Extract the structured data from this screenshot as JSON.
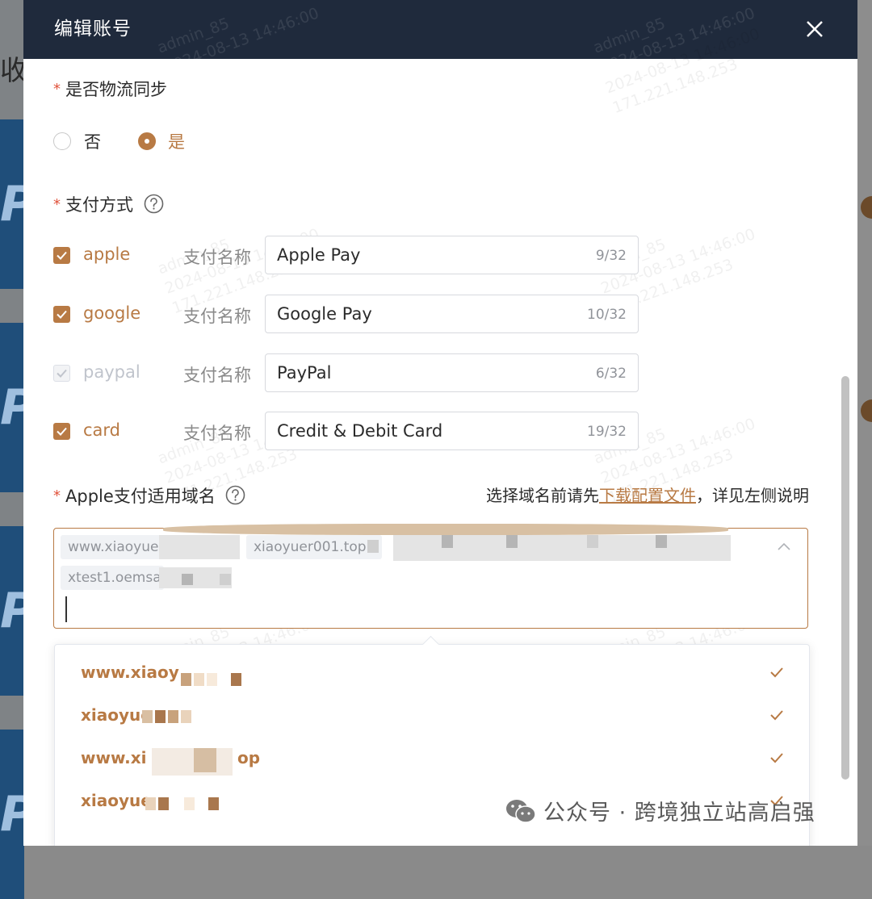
{
  "background": {
    "title_fragment": "收"
  },
  "modal": {
    "title": "编辑账号",
    "logistics": {
      "label": "是否物流同步",
      "options": [
        {
          "label": "否",
          "checked": false
        },
        {
          "label": "是",
          "checked": true
        }
      ]
    },
    "payment": {
      "label": "支付方式",
      "name_label": "支付名称",
      "methods": [
        {
          "key": "apple",
          "checked": true,
          "disabled": false,
          "name": "Apple Pay",
          "count": "9/32"
        },
        {
          "key": "google",
          "checked": true,
          "disabled": false,
          "name": "Google Pay",
          "count": "10/32"
        },
        {
          "key": "paypal",
          "checked": true,
          "disabled": true,
          "name": "PayPal",
          "count": "6/32"
        },
        {
          "key": "card",
          "checked": true,
          "disabled": false,
          "name": "Credit & Debit Card",
          "count": "19/32"
        }
      ]
    },
    "apple_domain": {
      "label": "Apple支付适用域名",
      "hint_prefix": "选择域名前请先",
      "hint_link": "下载配置文件",
      "hint_suffix": "，详见左侧说明",
      "tags": [
        "www.xiaoyuei",
        "xiaoyuer001.top",
        "xtest1.oemsaas"
      ],
      "options": [
        "www.xiaoy",
        "xiaoyue",
        "www.xi",
        "op",
        "xiaoyue"
      ]
    },
    "watermark": [
      "admin_85",
      "2024-08-13 14:46:00",
      "171.221.148.253"
    ]
  },
  "footer": {
    "wechat_text": "公众号 · 跨境独立站高启强"
  },
  "colors": {
    "accent": "#b87a44",
    "header": "#1f2a3c",
    "required": "#e0523b"
  }
}
